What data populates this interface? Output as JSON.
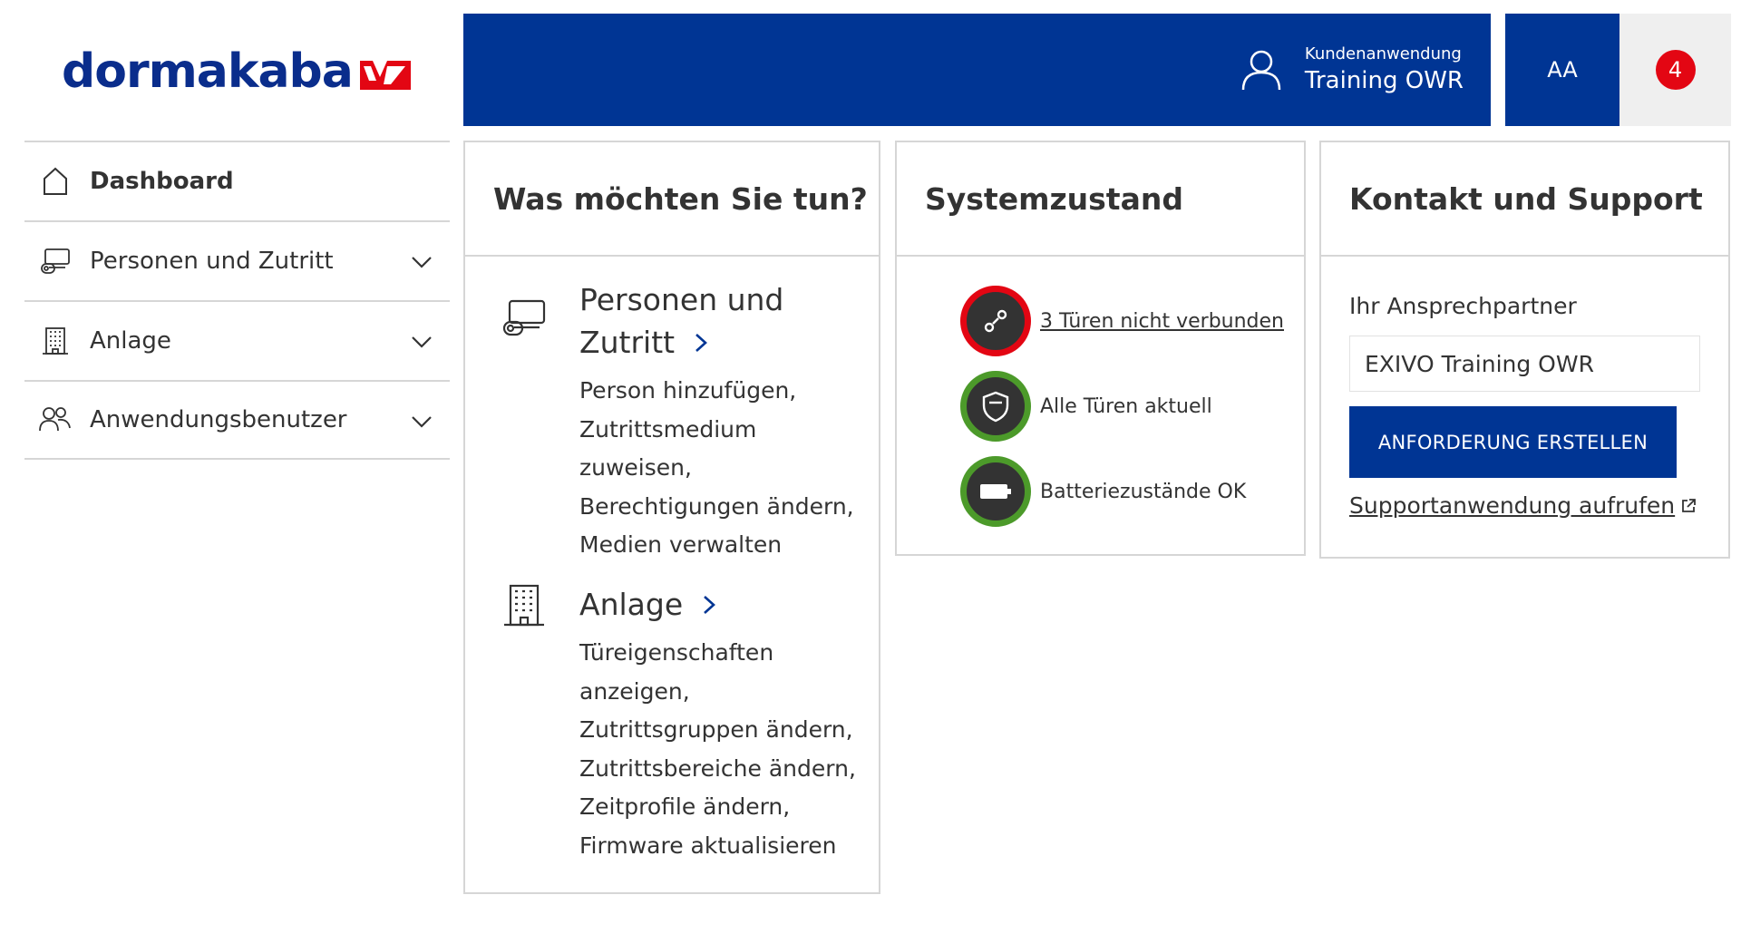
{
  "brand": {
    "logo_text": "dormakaba",
    "logo_color": "#0a2d8c",
    "mark_color": "#e30613"
  },
  "header": {
    "user_icon": "user-icon",
    "user_subtitle": "Kundenanwendung",
    "user_name": "Training OWR",
    "font_size_button": "AA",
    "notification_count": "4",
    "bar_color": "#003594"
  },
  "sidebar": {
    "items": [
      {
        "label": "Dashboard",
        "icon": "home-icon",
        "active": true
      },
      {
        "label": "Personen und Zutritt",
        "icon": "card-reader-icon",
        "expandable": true
      },
      {
        "label": "Anlage",
        "icon": "building-icon",
        "expandable": true
      },
      {
        "label": "Anwendungsbenutzer",
        "icon": "users-icon",
        "expandable": true
      }
    ]
  },
  "actions_card": {
    "title": "Was möchten Sie tun?",
    "items": [
      {
        "icon": "card-reader-icon",
        "title_line1": "Personen und",
        "title_line2": "Zutritt",
        "description": [
          "Person hinzufügen,",
          "Zutrittsmedium",
          "zuweisen,",
          "Berechtigungen ändern,",
          "Medien verwalten"
        ]
      },
      {
        "icon": "building-icon",
        "title_line1": "Anlage",
        "description": [
          "Türeigenschaften",
          "anzeigen,",
          "Zutrittsgruppen ändern,",
          "Zutrittsbereiche ändern,",
          "Zeitprofile ändern,",
          "Firmware aktualisieren"
        ]
      }
    ]
  },
  "status_card": {
    "title": "Systemzustand",
    "items": [
      {
        "text": "3 Türen nicht verbunden",
        "icon": "disconnected-icon",
        "state_color": "#e30613",
        "link": true
      },
      {
        "text": "Alle Türen aktuell",
        "icon": "shield-check-icon",
        "state_color": "#4c9a2a",
        "link": false
      },
      {
        "text": "Batteriezustände OK",
        "icon": "battery-icon",
        "state_color": "#4c9a2a",
        "link": false
      }
    ]
  },
  "support_card": {
    "title": "Kontakt und Support",
    "contact_label": "Ihr Ansprechpartner",
    "contact_value": "EXIVO Training OWR",
    "button_label": "ANFORDERUNG ERSTELLEN",
    "link_label": "Supportanwendung aufrufen",
    "link_icon": "external-link-icon"
  }
}
